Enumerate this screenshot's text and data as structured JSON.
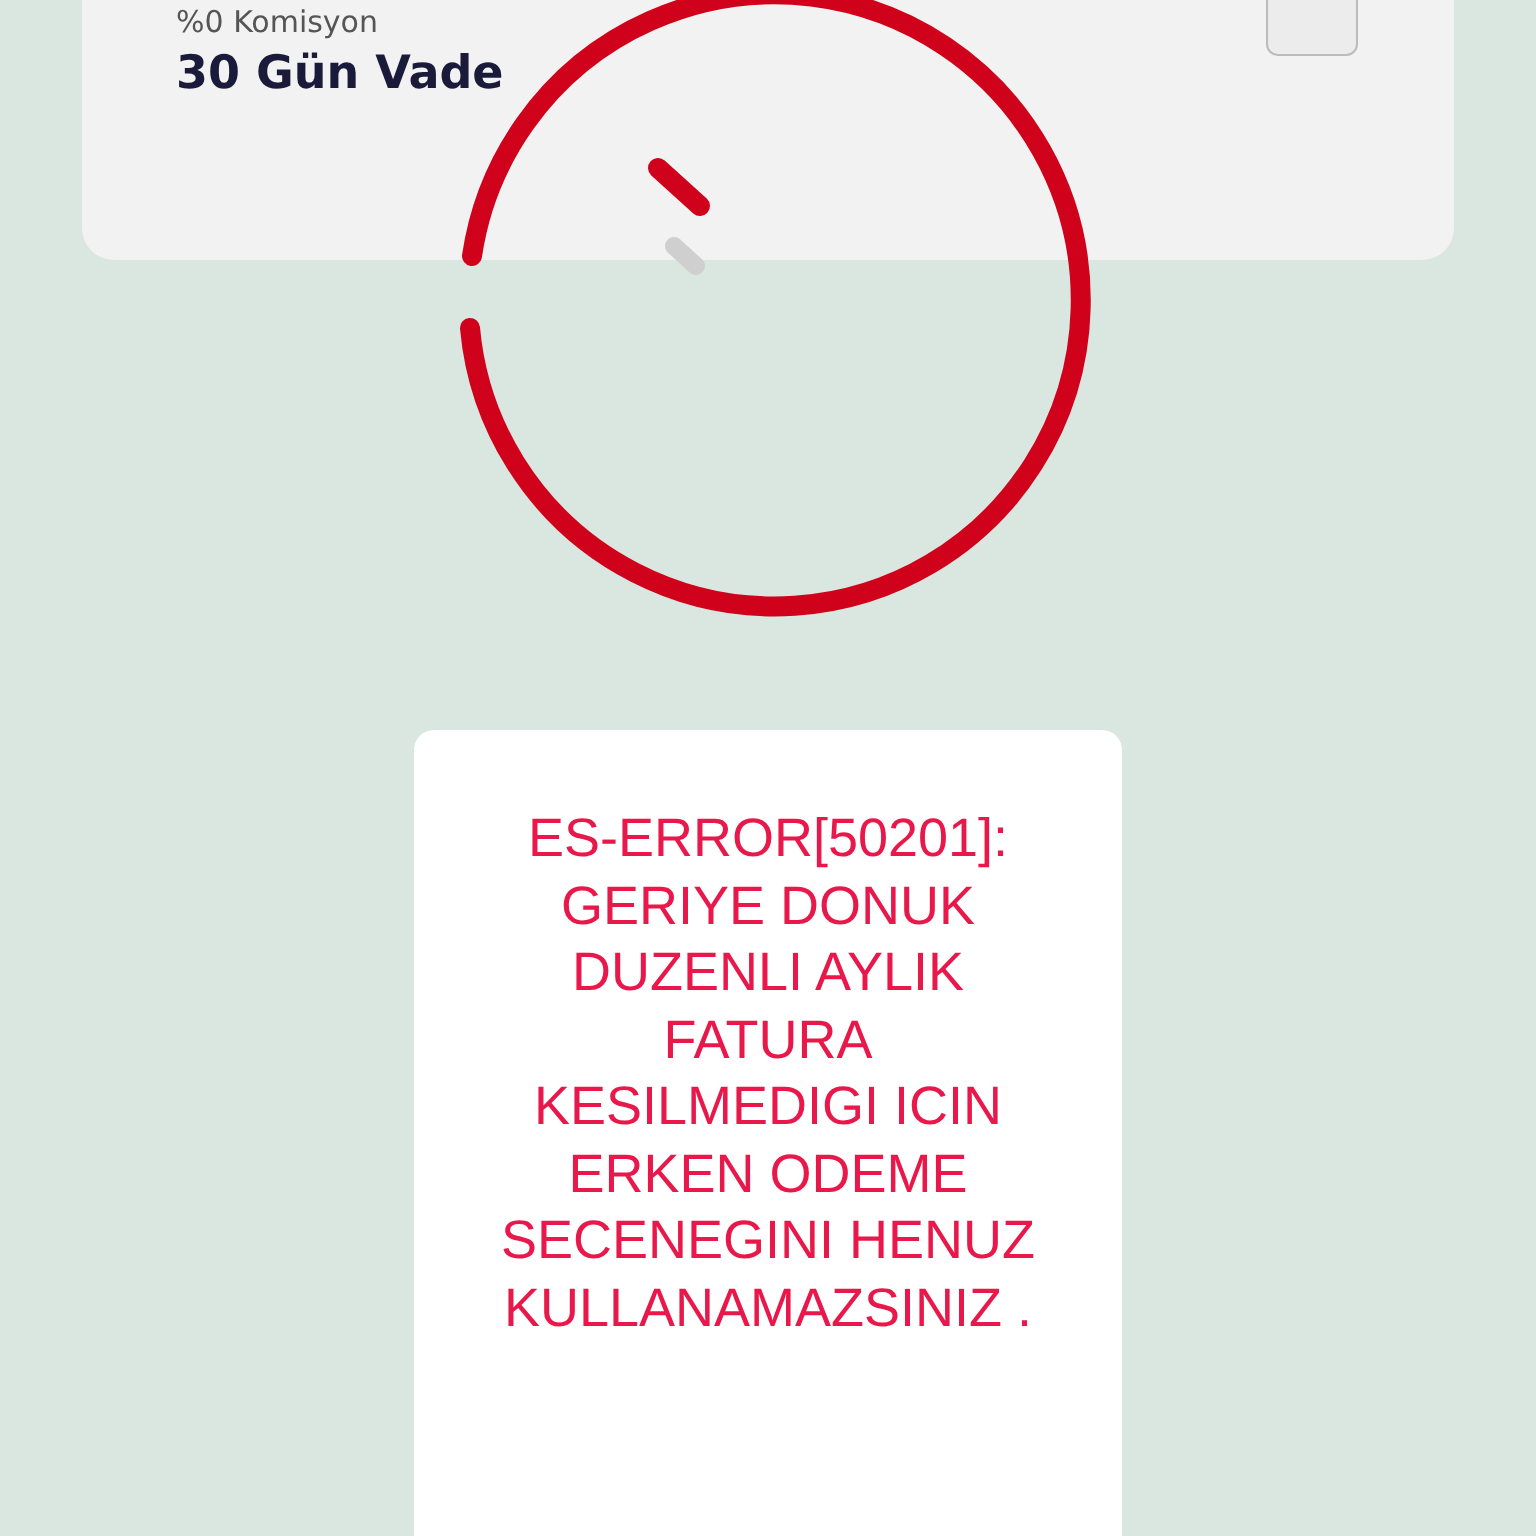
{
  "option_card": {
    "subtitle": "%0 Komisyon",
    "title": "30 Gün Vade",
    "checked": false
  },
  "error_dialog": {
    "message": "ES-ERROR[50201]: GERIYE DONUK DUZENLI AYLIK FATURA KESILMEDIGI ICIN ERKEN ODEME SECENEGINI HENUZ KULLANAMAZSINIZ ."
  }
}
